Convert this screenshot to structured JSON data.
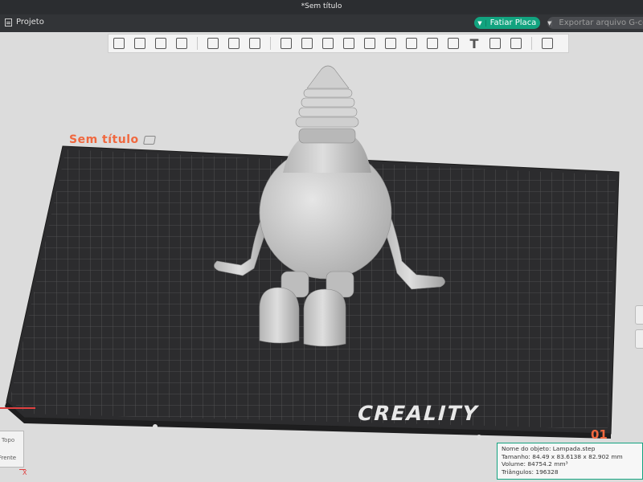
{
  "window": {
    "title": "*Sem título"
  },
  "menubar": {
    "project_label": "Projeto"
  },
  "actions": {
    "slice_label": "Fatiar Placa",
    "export_label": "Exportar arquivo G-code"
  },
  "toolbar": {
    "icons": [
      "add-object-icon",
      "grid-arrange-icon",
      "orient-icon",
      "plate-view-icon",
      "split-icon",
      "layout-icon",
      "list-icon",
      "move-icon",
      "rotate-icon",
      "scale-icon",
      "lay-on-face-icon",
      "cut-icon",
      "boolean-icon",
      "support-paint-icon",
      "seam-paint-icon",
      "color-paint-icon",
      "text-icon",
      "measure-icon",
      "assembly-icon",
      "puzzle-icon"
    ]
  },
  "plate": {
    "name": "Sem título",
    "number": "01",
    "brand": "CREALITY"
  },
  "navcube": {
    "face_top": "Topo",
    "face_front": "Frente",
    "axis_label": "X"
  },
  "object_info": {
    "name": "Nome do objeto: Lampada.step",
    "size": "Tamanho: 84.49 x 83.6138 x 82.902 mm",
    "volume": "Volume: 84754.2 mm³",
    "triangles": "Triângulos: 196328"
  },
  "colors": {
    "accent": "#12a37f",
    "plate_label": "#f0683f",
    "bed": "#2c2c2e",
    "model": "#c8c8c8"
  }
}
